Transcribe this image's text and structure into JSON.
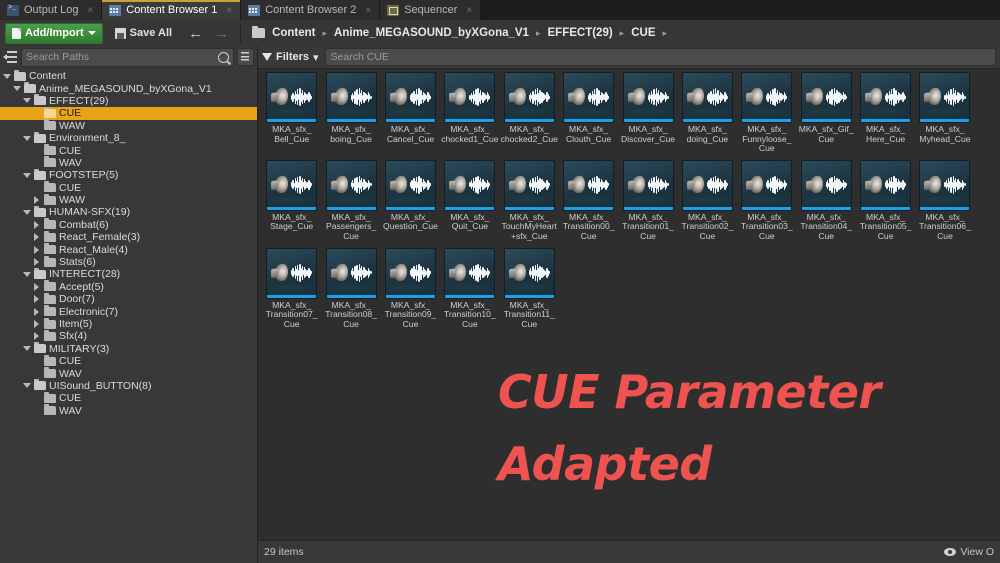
{
  "tabs": [
    {
      "label": "Output Log",
      "icon": "output-log-icon",
      "active": false,
      "close": "×"
    },
    {
      "label": "Content Browser 1",
      "icon": "content-browser-icon",
      "active": true,
      "close": "×"
    },
    {
      "label": "Content Browser 2",
      "icon": "content-browser-icon",
      "active": false,
      "close": "×"
    },
    {
      "label": "Sequencer",
      "icon": "sequencer-icon",
      "active": false,
      "close": "×"
    }
  ],
  "toolbar": {
    "add_import_label": "Add/Import",
    "add_import_caret": "▾",
    "save_all_label": "Save All",
    "back_arrow": "←",
    "forward_arrow": "→",
    "breadcrumb_sep": "▸",
    "breadcrumbs": [
      "Content",
      "Anime_MEGASOUND_byXGona_V1",
      "EFFECT(29)",
      "CUE"
    ]
  },
  "sidebar": {
    "search_placeholder": "Search Paths",
    "search_value": "",
    "tree": [
      {
        "label": "Content",
        "depth": 0,
        "state": "open",
        "selected": false
      },
      {
        "label": "Anime_MEGASOUND_byXGona_V1",
        "depth": 1,
        "state": "open",
        "selected": false
      },
      {
        "label": "EFFECT(29)",
        "depth": 2,
        "state": "open",
        "selected": false
      },
      {
        "label": "CUE",
        "depth": 3,
        "state": "leaf",
        "selected": true
      },
      {
        "label": "WAW",
        "depth": 3,
        "state": "leaf",
        "selected": false
      },
      {
        "label": "Environment_8_",
        "depth": 2,
        "state": "open",
        "selected": false
      },
      {
        "label": "CUE",
        "depth": 3,
        "state": "leaf",
        "selected": false
      },
      {
        "label": "WAV",
        "depth": 3,
        "state": "leaf",
        "selected": false
      },
      {
        "label": "FOOTSTEP(5)",
        "depth": 2,
        "state": "open",
        "selected": false
      },
      {
        "label": "CUE",
        "depth": 3,
        "state": "leaf",
        "selected": false
      },
      {
        "label": "WAW",
        "depth": 3,
        "state": "closed",
        "selected": false
      },
      {
        "label": "HUMAN-SFX(19)",
        "depth": 2,
        "state": "open",
        "selected": false
      },
      {
        "label": "Combat(6)",
        "depth": 3,
        "state": "closed",
        "selected": false
      },
      {
        "label": "React_Female(3)",
        "depth": 3,
        "state": "closed",
        "selected": false
      },
      {
        "label": "React_Male(4)",
        "depth": 3,
        "state": "closed",
        "selected": false
      },
      {
        "label": "Stats(6)",
        "depth": 3,
        "state": "closed",
        "selected": false
      },
      {
        "label": "INTERECT(28)",
        "depth": 2,
        "state": "open",
        "selected": false
      },
      {
        "label": "Accept(5)",
        "depth": 3,
        "state": "closed",
        "selected": false
      },
      {
        "label": "Door(7)",
        "depth": 3,
        "state": "closed",
        "selected": false
      },
      {
        "label": "Electronic(7)",
        "depth": 3,
        "state": "closed",
        "selected": false
      },
      {
        "label": "Item(5)",
        "depth": 3,
        "state": "closed",
        "selected": false
      },
      {
        "label": "Sfx(4)",
        "depth": 3,
        "state": "closed",
        "selected": false
      },
      {
        "label": "MILITARY(3)",
        "depth": 2,
        "state": "open",
        "selected": false
      },
      {
        "label": "CUE",
        "depth": 3,
        "state": "leaf",
        "selected": false
      },
      {
        "label": "WAV",
        "depth": 3,
        "state": "leaf",
        "selected": false
      },
      {
        "label": "UISound_BUTTON(8)",
        "depth": 2,
        "state": "open",
        "selected": false
      },
      {
        "label": "CUE",
        "depth": 3,
        "state": "leaf",
        "selected": false
      },
      {
        "label": "WAV",
        "depth": 3,
        "state": "leaf",
        "selected": false
      }
    ]
  },
  "content": {
    "filters_label": "Filters",
    "filters_caret": "▾",
    "search_placeholder": "Search CUE",
    "search_value": "",
    "assets": [
      {
        "name": "MKA_sfx_Bell_Cue"
      },
      {
        "name": "MKA_sfx_boing_Cue"
      },
      {
        "name": "MKA_sfx_Cancel_Cue"
      },
      {
        "name": "MKA_sfx_chocked1_Cue"
      },
      {
        "name": "MKA_sfx_chocked2_Cue"
      },
      {
        "name": "MKA_sfx_Clouth_Cue"
      },
      {
        "name": "MKA_sfx_Discover_Cue"
      },
      {
        "name": "MKA_sfx_doing_Cue"
      },
      {
        "name": "MKA_sfx_Funnyloose_Cue"
      },
      {
        "name": "MKA_sfx_Gif_Cue"
      },
      {
        "name": "MKA_sfx_Here_Cue"
      },
      {
        "name": "MKA_sfx_Myhead_Cue"
      },
      {
        "name": "MKA_sfx_Stage_Cue"
      },
      {
        "name": "MKA_sfx_Passengers_Cue"
      },
      {
        "name": "MKA_sfx_Question_Cue"
      },
      {
        "name": "MKA_sfx_Quit_Cue"
      },
      {
        "name": "MKA_sfx_TouchMyHeart+sfx_Cue"
      },
      {
        "name": "MKA_sfx_Transition00_Cue"
      },
      {
        "name": "MKA_sfx_Transition01_Cue"
      },
      {
        "name": "MKA_sfx_Transition02_Cue"
      },
      {
        "name": "MKA_sfx_Transition03_Cue"
      },
      {
        "name": "MKA_sfx_Transition04_Cue"
      },
      {
        "name": "MKA_sfx_Transition05_Cue"
      },
      {
        "name": "MKA_sfx_Transition06_Cue"
      },
      {
        "name": "MKA_sfx_Transition07_Cue"
      },
      {
        "name": "MKA_sfx_Transition08_Cue"
      },
      {
        "name": "MKA_sfx_Transition09_Cue"
      },
      {
        "name": "MKA_sfx_Transition10_Cue"
      },
      {
        "name": "MKA_sfx_Transition11_Cue"
      }
    ],
    "status_count": "29 items",
    "view_options_label": "View O"
  },
  "overlay": {
    "line1": "CUE Parameter",
    "line2": "Adapted",
    "color": "#ef5350"
  },
  "colors": {
    "selection": "#e8a317",
    "accent_tab": "#c8a13a",
    "add_import": "#3f8f3f",
    "asset_bar": "#1ea0e8"
  }
}
